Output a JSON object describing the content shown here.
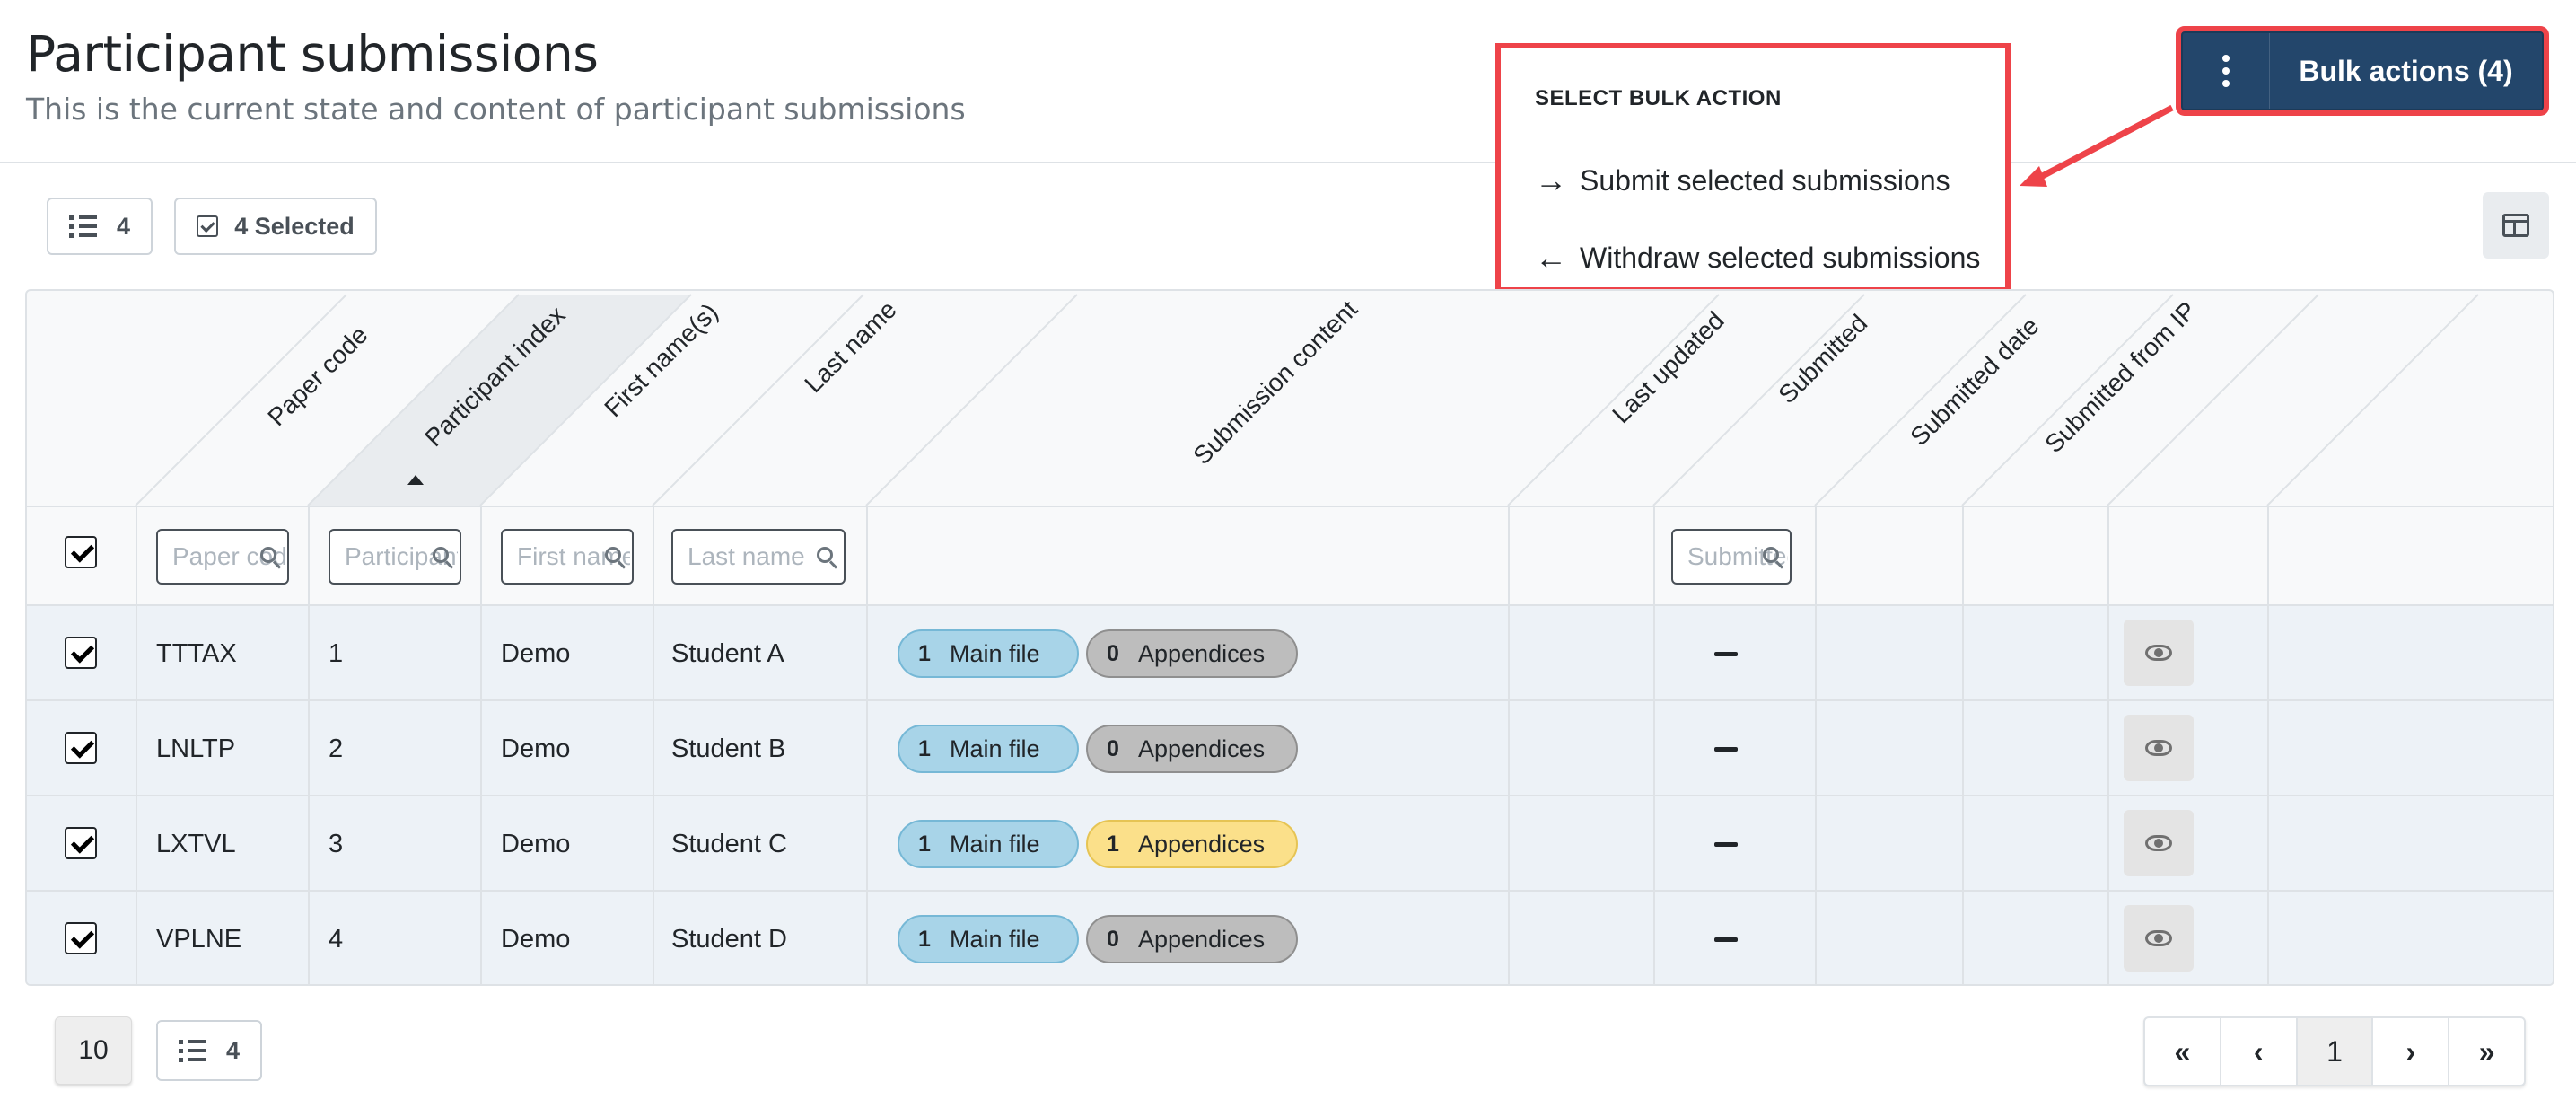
{
  "header": {
    "title": "Participant submissions",
    "subtitle": "This is the current state and content of participant submissions"
  },
  "bulk": {
    "button_label": "Bulk actions (4)",
    "menu_heading": "SELECT BULK ACTION",
    "items": [
      {
        "arrow": "→",
        "label": "Submit selected submissions"
      },
      {
        "arrow": "←",
        "label": "Withdraw selected submissions"
      }
    ],
    "highlight_color": "#ee4349"
  },
  "toolbar": {
    "row_count": "4",
    "selected_label": "4 Selected"
  },
  "table": {
    "columns": [
      "Paper code",
      "Participant index",
      "First name(s)",
      "Last name",
      "Submission content",
      "Last updated",
      "Submitted",
      "Submitted date",
      "Submitted from IP"
    ],
    "filters": {
      "paper_code": "Paper code",
      "participant_index": "Participant index",
      "first_name": "First name(s)",
      "last_name": "Last name",
      "last_updated": "Submitted"
    },
    "main_file_label": "Main file",
    "appendices_label": "Appendices",
    "last_updated_value": "—",
    "rows": [
      {
        "paper_code": "TTTAX",
        "index": "1",
        "first": "Demo",
        "last": "Student A",
        "main": "1",
        "app": "0",
        "selected": true
      },
      {
        "paper_code": "LNLTP",
        "index": "2",
        "first": "Demo",
        "last": "Student B",
        "main": "1",
        "app": "0",
        "selected": true
      },
      {
        "paper_code": "LXTVL",
        "index": "3",
        "first": "Demo",
        "last": "Student C",
        "main": "1",
        "app": "1",
        "selected": true
      },
      {
        "paper_code": "VPLNE",
        "index": "4",
        "first": "Demo",
        "last": "Student D",
        "main": "1",
        "app": "0",
        "selected": true
      }
    ]
  },
  "footer": {
    "page_size": "10",
    "total": "4",
    "pager": {
      "first": "«",
      "prev": "‹",
      "current": "1",
      "next": "›",
      "last": "»"
    }
  }
}
